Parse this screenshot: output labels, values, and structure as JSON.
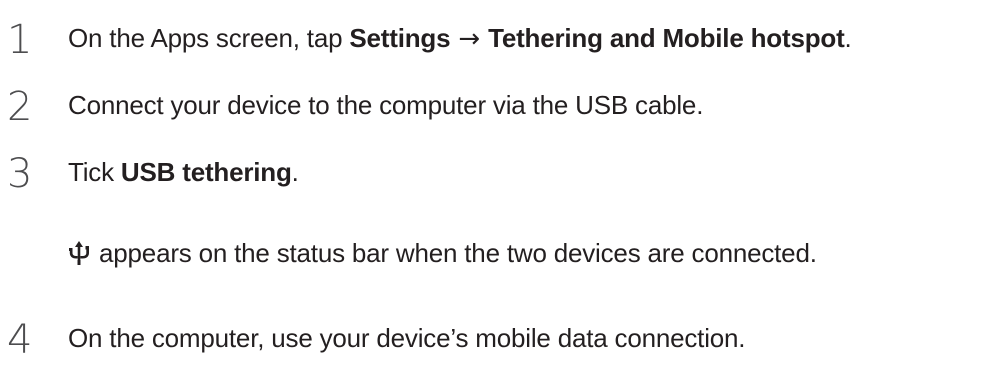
{
  "steps": [
    {
      "number": "1",
      "text_before": "On the Apps screen, tap ",
      "bold1": "Settings",
      "arrow": " → ",
      "bold2": "Tethering and Mobile hotspot",
      "text_after": "."
    },
    {
      "number": "2",
      "text": "Connect your device to the computer via the USB cable."
    },
    {
      "number": "3",
      "text_before": "Tick ",
      "bold": "USB tethering",
      "text_after": ".",
      "note_icon": "usb-icon",
      "note_text": " appears on the status bar when the two devices are connected."
    },
    {
      "number": "4",
      "text": "On the computer, use your device’s mobile data connection."
    }
  ]
}
